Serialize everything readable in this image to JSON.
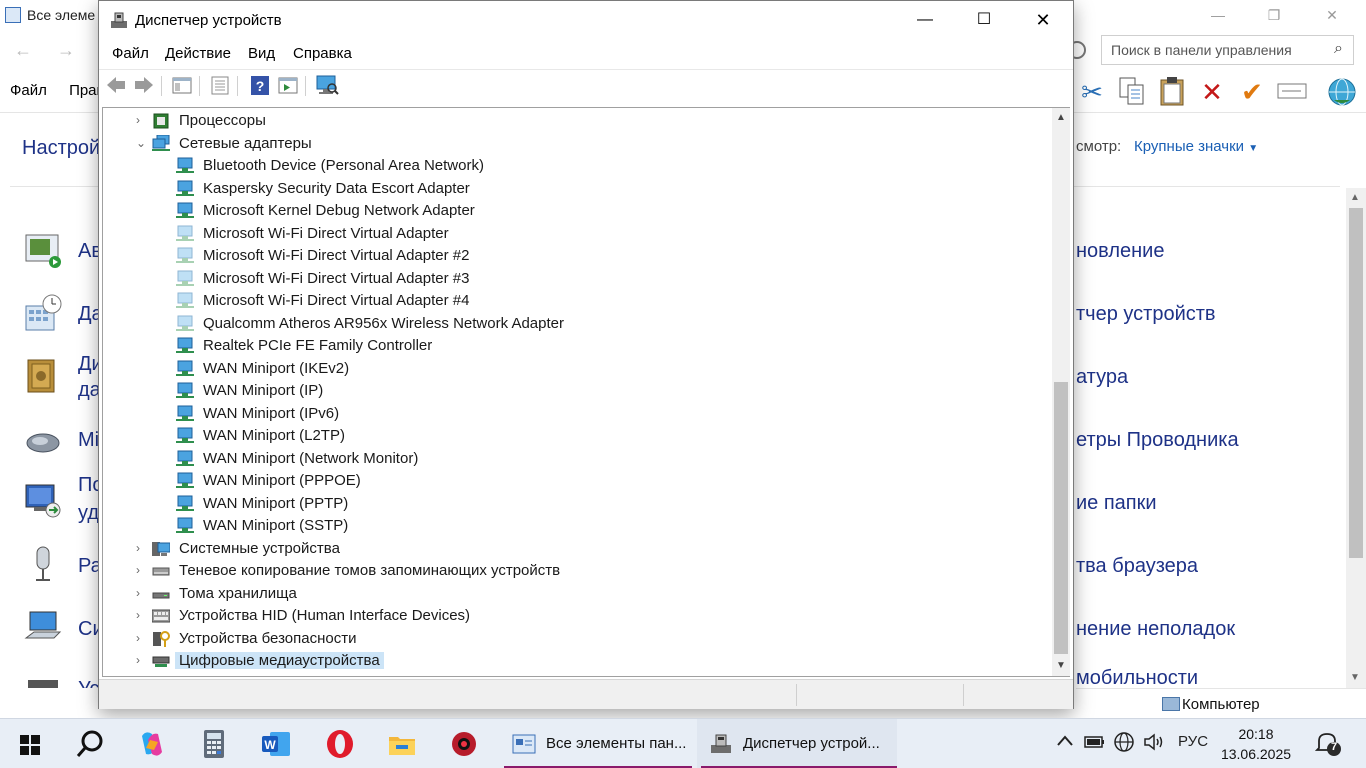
{
  "control_panel": {
    "title": "Все элеме",
    "search_placeholder": "Поиск в панели управления",
    "menu": [
      "Файл",
      "Прав"
    ],
    "heading": "Настрой",
    "view_label": "смотр:",
    "view_value": "Крупные значки",
    "left_items": [
      {
        "label": "Ав",
        "icon": "autoplay-icon"
      },
      {
        "label": "Да",
        "icon": "datetime-icon"
      },
      {
        "label": "Ди",
        "label2": "да",
        "icon": "safe-icon"
      },
      {
        "label": "Мі",
        "icon": "mouse-icon"
      },
      {
        "label": "По",
        "label2": "уд",
        "icon": "remote-icon"
      },
      {
        "label": "Ра",
        "icon": "microphone-icon"
      },
      {
        "label": "Си",
        "icon": "computer-icon"
      },
      {
        "label": "Ус",
        "icon": "keyboard-icon"
      }
    ],
    "right_items": [
      "новление",
      "тчер устройств",
      "атура",
      "етры Проводника",
      "ие папки",
      "тва браузера",
      "нение неполадок",
      "мобильности"
    ],
    "status_text": "Компьютер"
  },
  "device_manager": {
    "title": "Диспетчер устройств",
    "menu": [
      "Файл",
      "Действие",
      "Вид",
      "Справка"
    ],
    "tree": [
      {
        "label": "Процессоры",
        "level": 0,
        "expand": "›",
        "icon": "cpu-icon"
      },
      {
        "label": "Сетевые адаптеры",
        "level": 0,
        "expand": "⌄",
        "icon": "network-adapters-icon"
      },
      {
        "label": "Bluetooth Device (Personal Area Network)",
        "level": 1,
        "icon": "network-adapter-icon"
      },
      {
        "label": "Kaspersky Security Data Escort Adapter",
        "level": 1,
        "icon": "network-adapter-icon"
      },
      {
        "label": "Microsoft Kernel Debug Network Adapter",
        "level": 1,
        "icon": "network-adapter-icon"
      },
      {
        "label": "Microsoft Wi-Fi Direct Virtual Adapter",
        "level": 1,
        "icon": "network-adapter-disabled-icon",
        "faded": true
      },
      {
        "label": "Microsoft Wi-Fi Direct Virtual Adapter #2",
        "level": 1,
        "icon": "network-adapter-disabled-icon",
        "faded": true
      },
      {
        "label": "Microsoft Wi-Fi Direct Virtual Adapter #3",
        "level": 1,
        "icon": "network-adapter-disabled-icon",
        "faded": true
      },
      {
        "label": "Microsoft Wi-Fi Direct Virtual Adapter #4",
        "level": 1,
        "icon": "network-adapter-disabled-icon",
        "faded": true
      },
      {
        "label": "Qualcomm Atheros AR956x Wireless Network Adapter",
        "level": 1,
        "icon": "network-adapter-disabled-icon",
        "faded": true
      },
      {
        "label": "Realtek PCIe FE Family Controller",
        "level": 1,
        "icon": "network-adapter-icon"
      },
      {
        "label": "WAN Miniport (IKEv2)",
        "level": 1,
        "icon": "network-adapter-icon"
      },
      {
        "label": "WAN Miniport (IP)",
        "level": 1,
        "icon": "network-adapter-icon"
      },
      {
        "label": "WAN Miniport (IPv6)",
        "level": 1,
        "icon": "network-adapter-icon"
      },
      {
        "label": "WAN Miniport (L2TP)",
        "level": 1,
        "icon": "network-adapter-icon"
      },
      {
        "label": "WAN Miniport (Network Monitor)",
        "level": 1,
        "icon": "network-adapter-icon"
      },
      {
        "label": "WAN Miniport (PPPOE)",
        "level": 1,
        "icon": "network-adapter-icon"
      },
      {
        "label": "WAN Miniport (PPTP)",
        "level": 1,
        "icon": "network-adapter-icon"
      },
      {
        "label": "WAN Miniport (SSTP)",
        "level": 1,
        "icon": "network-adapter-icon"
      },
      {
        "label": "Системные устройства",
        "level": 0,
        "expand": "›",
        "icon": "system-devices-icon"
      },
      {
        "label": "Теневое копирование томов запоминающих устройств",
        "level": 0,
        "expand": "›",
        "icon": "volume-shadow-copy-icon"
      },
      {
        "label": "Тома хранилища",
        "level": 0,
        "expand": "›",
        "icon": "storage-volumes-icon"
      },
      {
        "label": "Устройства HID (Human Interface Devices)",
        "level": 0,
        "expand": "›",
        "icon": "hid-icon"
      },
      {
        "label": "Устройства безопасности",
        "level": 0,
        "expand": "›",
        "icon": "security-devices-icon"
      },
      {
        "label": "Цифровые медиаустройства",
        "level": 0,
        "expand": "›",
        "icon": "digital-media-icon",
        "selected": true
      }
    ]
  },
  "taskbar": {
    "tasks": [
      {
        "label": "Все элементы пан...",
        "icon": "control-panel-icon"
      },
      {
        "label": "Диспетчер устрой...",
        "icon": "device-manager-icon"
      }
    ],
    "lang": "РУС",
    "time": "20:18",
    "date": "13.06.2025",
    "notifications": "7"
  }
}
